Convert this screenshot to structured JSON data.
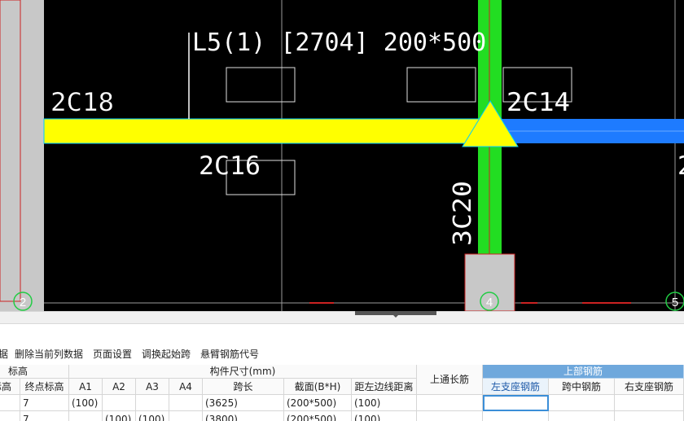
{
  "drawing": {
    "beam_label": "L5(1) [2704] 200*500",
    "rebar_top_left": "2C18",
    "rebar_top_right": "2C14",
    "rebar_bottom": "2C16",
    "rebar_column_vertical": "3C20",
    "axis_left": "2",
    "axis_middle": "4",
    "axis_right": "5",
    "colors": {
      "beam_yellow": "#ffff00",
      "beam_blue": "#1e7bff",
      "column_green": "#22dd22",
      "column_gray": "#c8c8c8",
      "background": "#000000"
    }
  },
  "toolbar": {
    "items": [
      "据",
      "删除当前列数据",
      "页面设置",
      "调换起始跨",
      "悬臂钢筋代号"
    ]
  },
  "table": {
    "group_headers": {
      "elevation": "标高",
      "dimensions": "构件尺寸(mm)",
      "top_rebar": "上部钢筋"
    },
    "columns": {
      "start_elev": "标高",
      "end_elev": "终点标高",
      "a1": "A1",
      "a2": "A2",
      "a3": "A3",
      "a4": "A4",
      "span": "跨长",
      "section": "截面(B*H)",
      "edge_dist": "距左边线距离",
      "continuous": "上通长筋",
      "left_support": "左支座钢筋",
      "mid_span": "跨中钢筋",
      "right_support": "右支座钢筋"
    },
    "rows": [
      {
        "end_elev": "7",
        "a1": "(100)",
        "a2": "",
        "a3": "",
        "a4": "",
        "span": "(3625)",
        "section": "(200*500)",
        "edge_dist": "(100)"
      },
      {
        "end_elev": "7",
        "a1": "",
        "a2": "(100)",
        "a3": "(100)",
        "a4": "",
        "span": "(3800)",
        "section": "(200*500)",
        "edge_dist": "(100)"
      }
    ]
  }
}
